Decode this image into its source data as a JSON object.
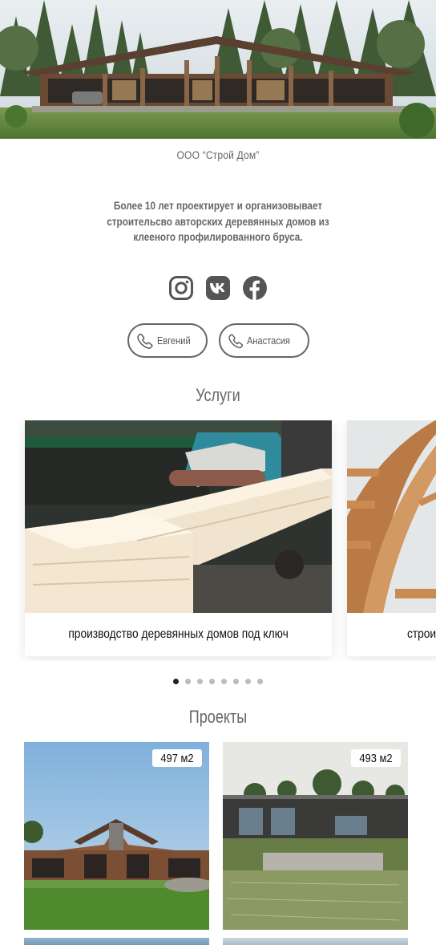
{
  "company_name": "ООО “Строй Дом”",
  "tagline": "Более 10 лет проектирует и организовывает строительсво авторских деревянных домов из клееного профилированного бруса.",
  "socials": [
    {
      "name": "instagram",
      "icon": "instagram-icon"
    },
    {
      "name": "vk",
      "icon": "vk-icon"
    },
    {
      "name": "facebook",
      "icon": "facebook-icon"
    }
  ],
  "phones": [
    {
      "label": "Евгений",
      "icon": "phone-icon"
    },
    {
      "label": "Анастасия",
      "icon": "phone-icon"
    }
  ],
  "services": {
    "title": "Услуги",
    "cards": [
      {
        "caption": "производство деревянных домов под ключ"
      },
      {
        "caption": "строи"
      }
    ],
    "dots_count": 8,
    "active_dot": 0
  },
  "projects": {
    "title": "Проекты",
    "items": [
      {
        "area": "497 м2"
      },
      {
        "area": "493 м2"
      }
    ]
  },
  "colors": {
    "text": "#666666",
    "accent": "#222222",
    "dot_inactive": "#bdbdbd"
  }
}
